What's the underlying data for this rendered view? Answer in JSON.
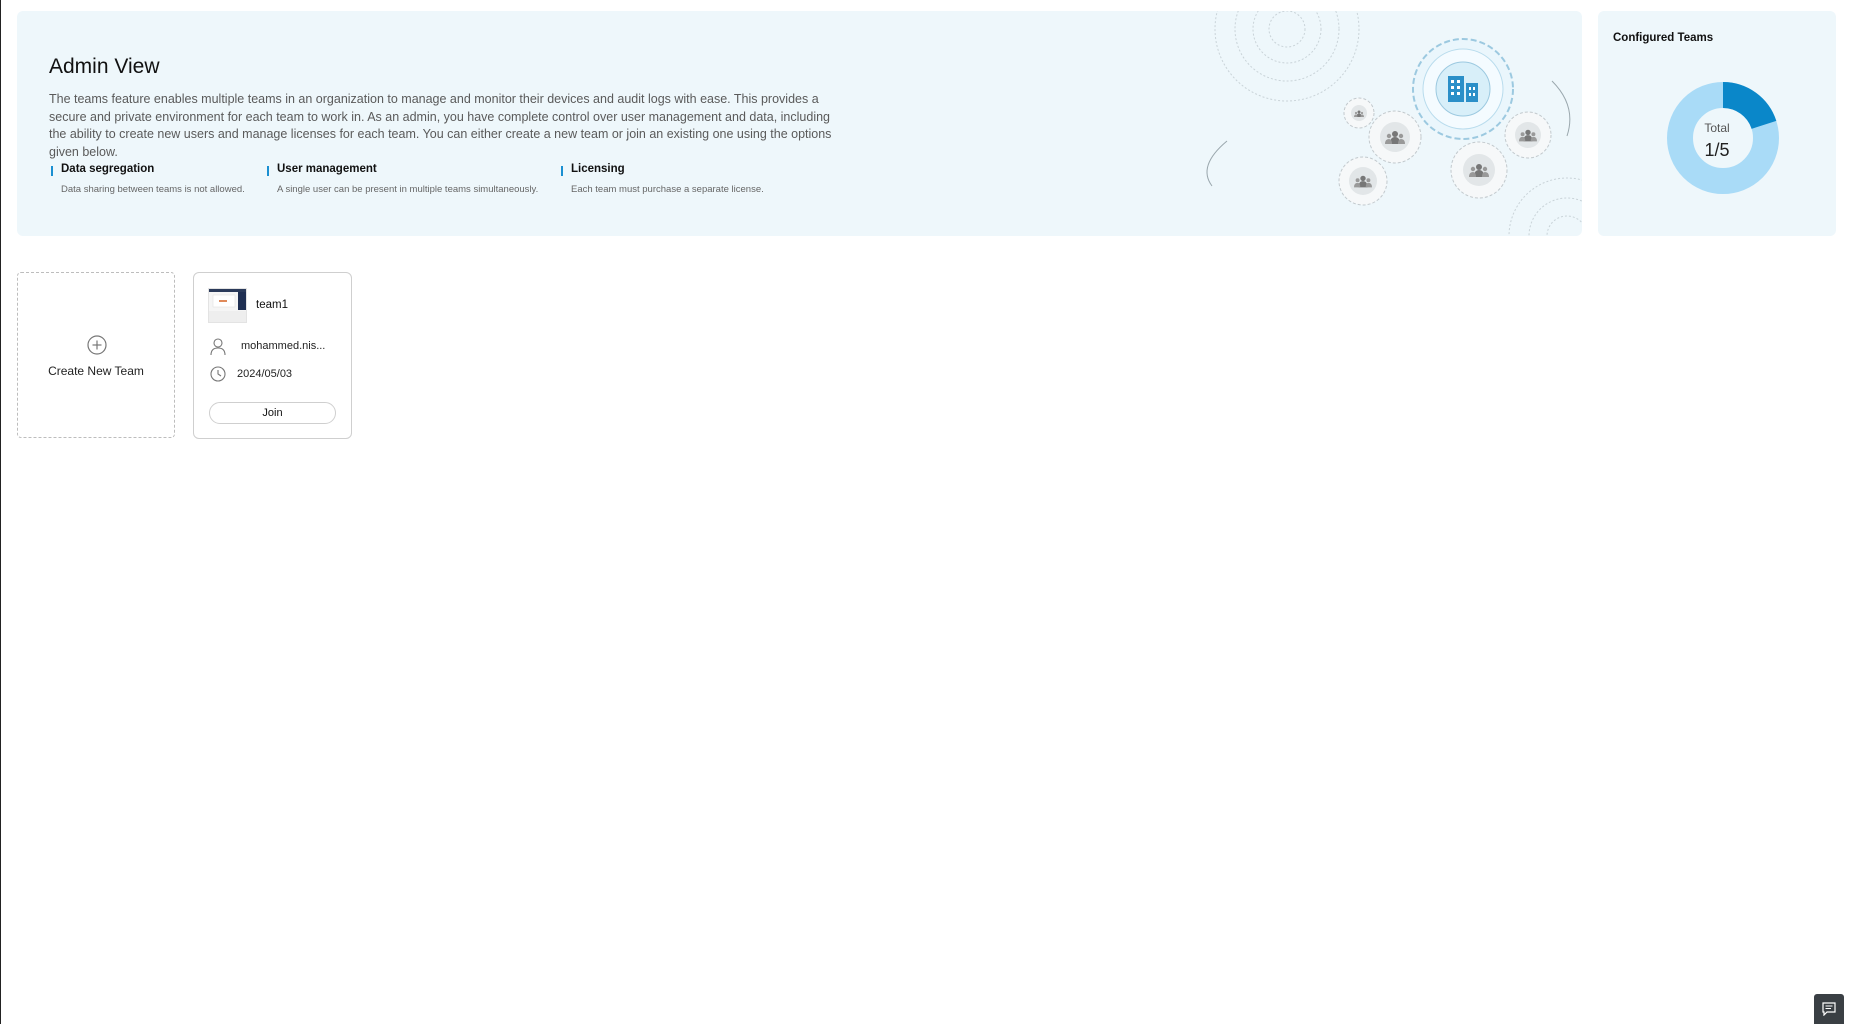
{
  "hero": {
    "title": "Admin View",
    "description": "The teams feature enables multiple teams in an organization to manage and monitor their devices and audit logs with ease. This provides a secure and private environment for each team to work in. As an admin, you have complete control over user management and data, including the ability to create new users and manage licenses for each team. You can either create a new team or join an existing one using the options given below.",
    "features": [
      {
        "title": "Data segregation",
        "desc": "Data sharing between teams is not allowed."
      },
      {
        "title": "User management",
        "desc": "A single user can be present in multiple teams simultaneously."
      },
      {
        "title": "Licensing",
        "desc": "Each team must purchase a separate license."
      }
    ],
    "illustration_icons": [
      "building-icon",
      "team-gear-icon"
    ]
  },
  "summary": {
    "title": "Configured Teams",
    "total_label": "Total",
    "total_value": "1/5",
    "configured": 1,
    "limit": 5,
    "colors": {
      "filled": "#0a87c9",
      "remaining": "#a9dbf7"
    }
  },
  "create_card": {
    "label": "Create New Team",
    "icon": "plus-circle-icon"
  },
  "team_card": {
    "name": "team1",
    "owner": "mohammed.nis...",
    "date": "2024/05/03",
    "join_label": "Join"
  },
  "chat": {
    "icon": "chat-icon"
  },
  "colors": {
    "accent": "#1a8fd1",
    "panel_bg": "#eef7fb"
  }
}
